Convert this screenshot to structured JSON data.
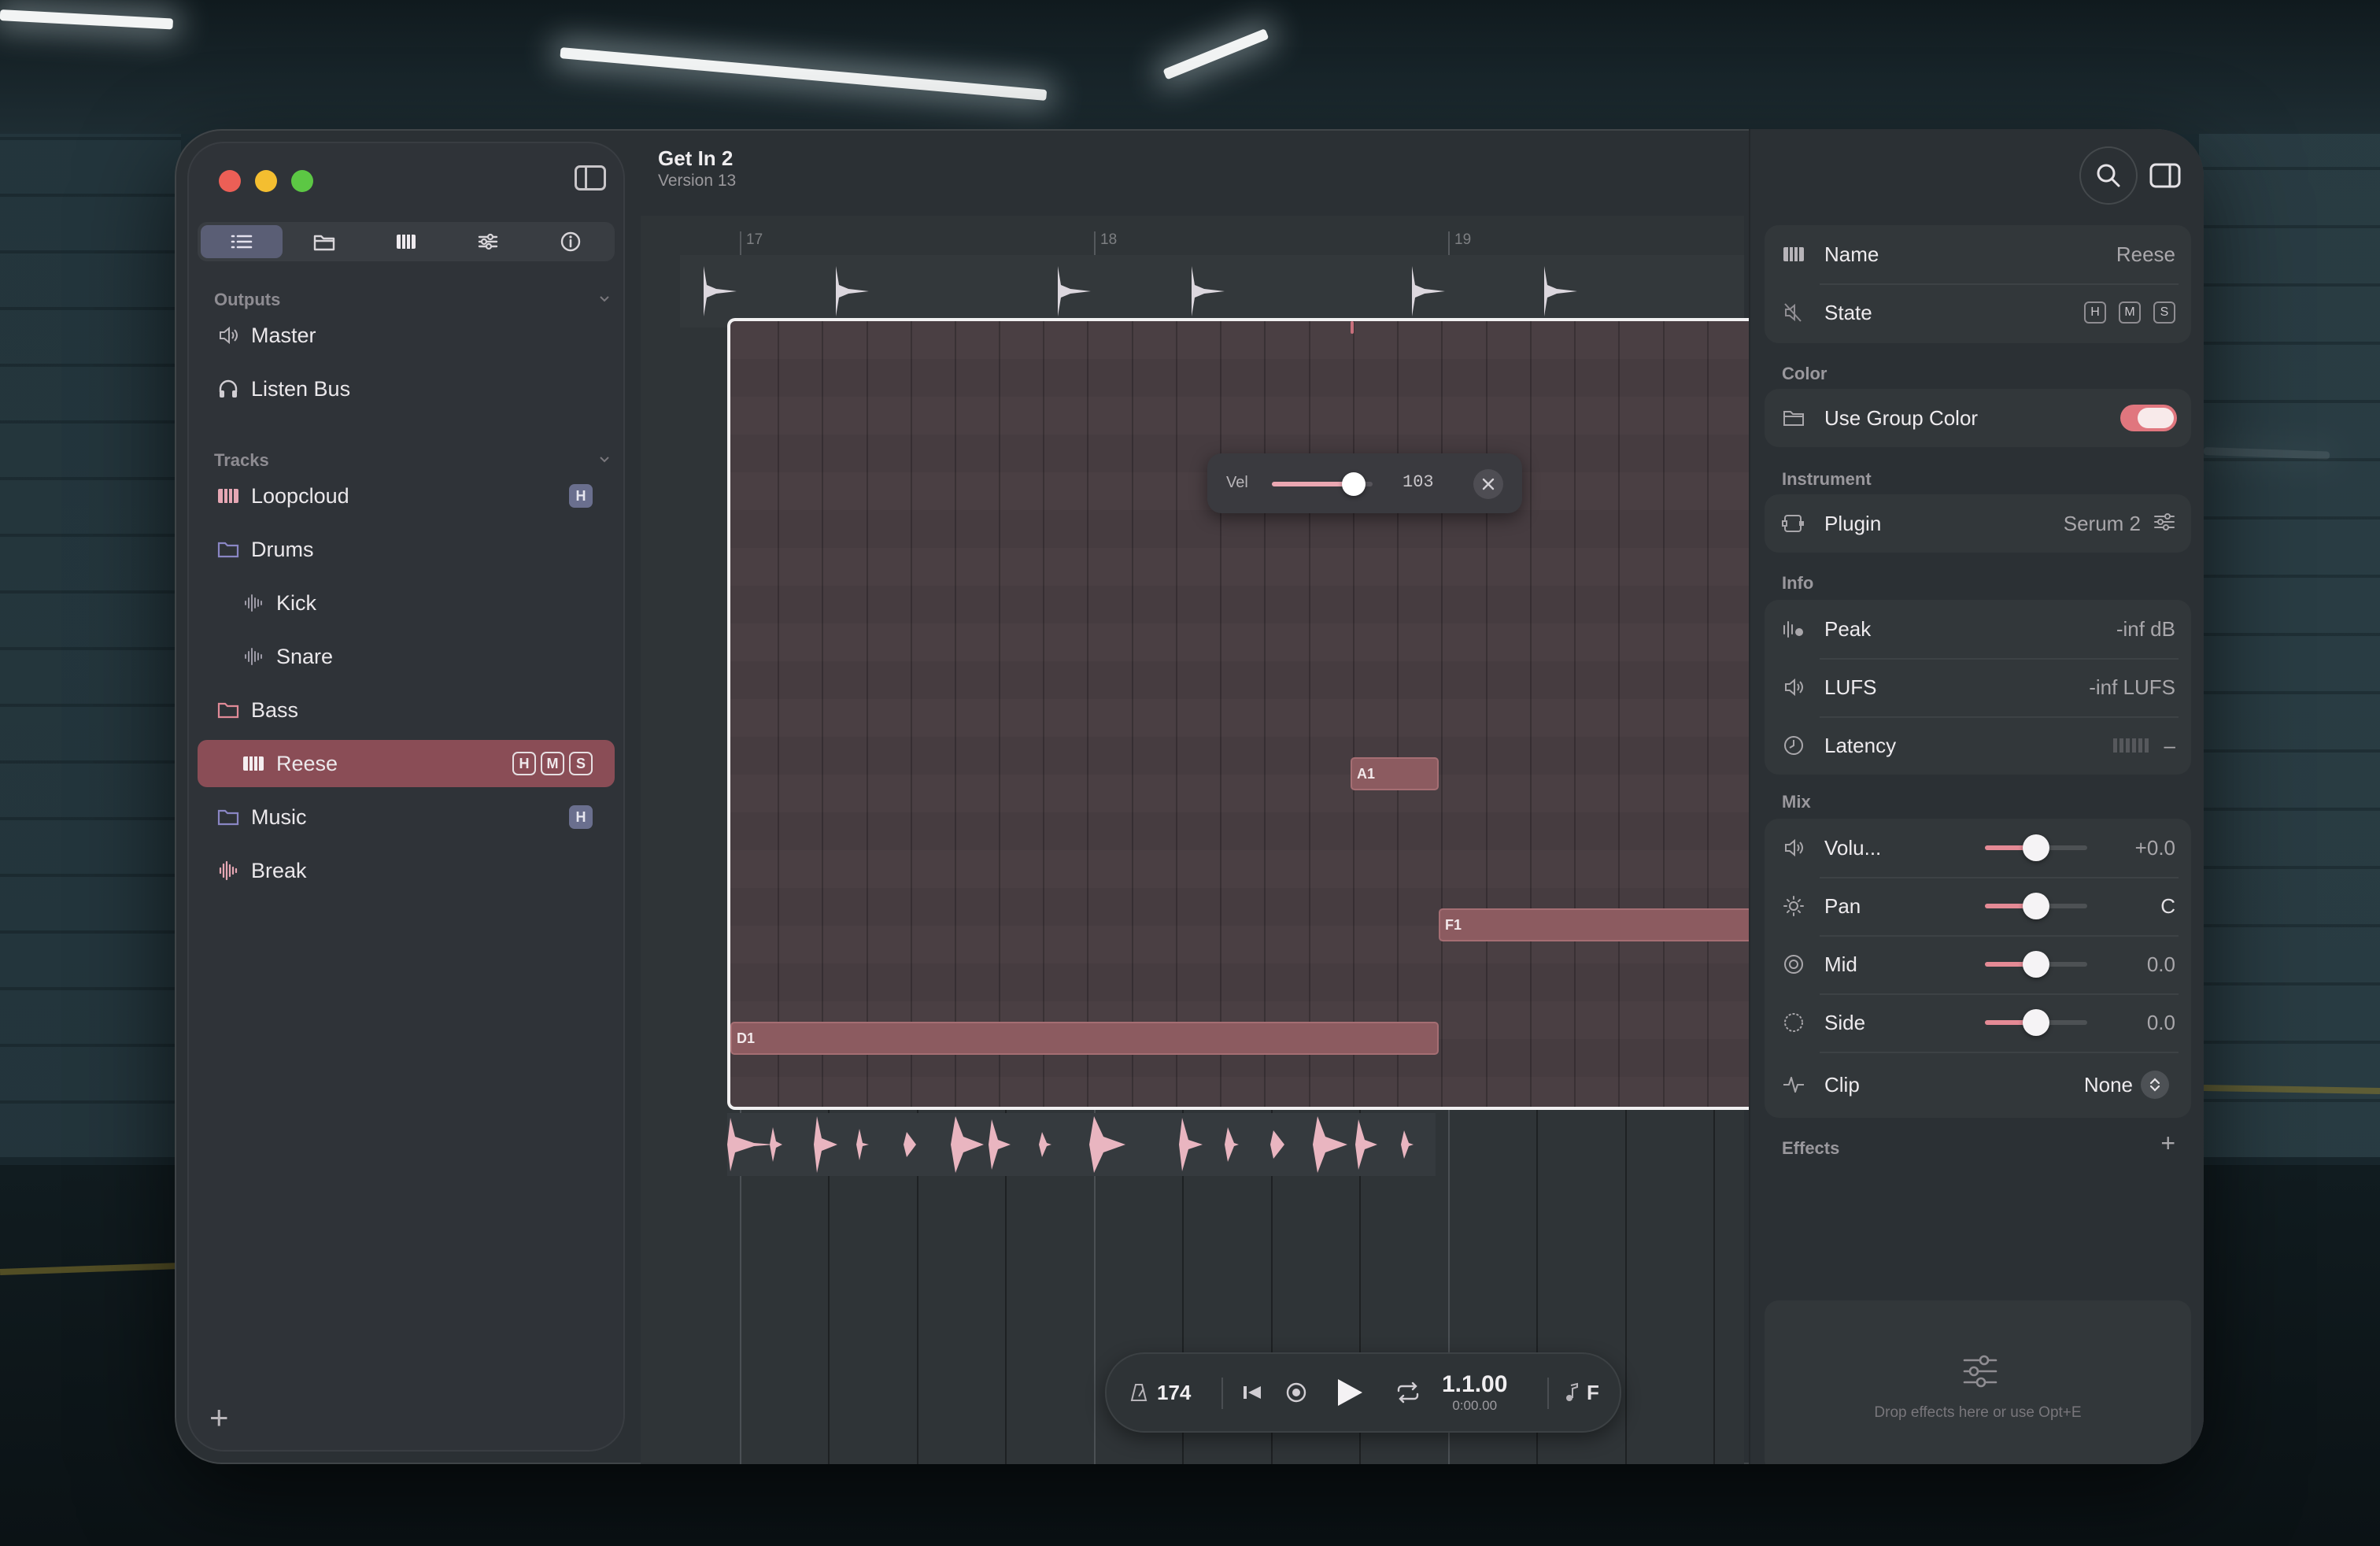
{
  "window": {
    "title": "Get In 2",
    "subtitle": "Version 13"
  },
  "sidebar": {
    "tabs": [
      {
        "icon": "list-icon",
        "active": true
      },
      {
        "icon": "folder-icon",
        "active": false
      },
      {
        "icon": "piano-icon",
        "active": false
      },
      {
        "icon": "mixer-icon",
        "active": false
      },
      {
        "icon": "info-icon",
        "active": false
      }
    ],
    "outputs_title": "Outputs",
    "outputs": [
      {
        "label": "Master",
        "icon": "speaker-icon"
      },
      {
        "label": "Listen Bus",
        "icon": "headphones-icon"
      }
    ],
    "tracks_title": "Tracks",
    "tracks": [
      {
        "label": "Loopcloud",
        "icon": "piano-icon",
        "badges": [
          "H"
        ]
      },
      {
        "label": "Drums",
        "icon": "folder-icon"
      },
      {
        "label": "Kick",
        "icon": "waveform-icon"
      },
      {
        "label": "Snare",
        "icon": "waveform-icon"
      },
      {
        "label": "Bass",
        "icon": "folder-icon"
      },
      {
        "label": "Reese",
        "icon": "piano-icon",
        "badges": [
          "H",
          "M",
          "S"
        ],
        "selected": true
      },
      {
        "label": "Music",
        "icon": "folder-icon",
        "badges": [
          "H"
        ]
      },
      {
        "label": "Break",
        "icon": "waveform-icon"
      }
    ],
    "add_label": "+"
  },
  "editor": {
    "ruler": [
      "17",
      "18",
      "19"
    ],
    "notes": [
      {
        "label": "A1"
      },
      {
        "label": "F1"
      },
      {
        "label": "D1"
      }
    ],
    "velocity": {
      "label": "Vel",
      "value": "103",
      "level": 0.81
    }
  },
  "transport": {
    "bpm": "174",
    "position": "1.1.00",
    "time": "0:00.00",
    "key": "F"
  },
  "inspector": {
    "name_label": "Name",
    "name_value": "Reese",
    "state_label": "State",
    "state_buttons": [
      "H",
      "M",
      "S"
    ],
    "color_section": "Color",
    "use_group_color": "Use Group Color",
    "use_group_color_on": true,
    "instrument_section": "Instrument",
    "plugin_label": "Plugin",
    "plugin_value": "Serum 2",
    "info_section": "Info",
    "peak_label": "Peak",
    "peak_value": "-inf dB",
    "lufs_label": "LUFS",
    "lufs_value": "-inf LUFS",
    "latency_label": "Latency",
    "latency_value": "–",
    "mix_section": "Mix",
    "mix": [
      {
        "label": "Volu...",
        "value": "+0.0",
        "level": 0.5,
        "icon": "speaker-icon"
      },
      {
        "label": "Pan",
        "value": "C",
        "level": 0.5,
        "icon": "sun-icon"
      },
      {
        "label": "Mid",
        "value": "0.0",
        "level": 0.5,
        "icon": "target-icon"
      },
      {
        "label": "Side",
        "value": "0.0",
        "level": 0.5,
        "icon": "circle-icon"
      }
    ],
    "clip_label": "Clip",
    "clip_value": "None",
    "effects_section": "Effects",
    "effects_add": "+",
    "effects_hint": "Drop effects here or use Opt+E"
  },
  "colors": {
    "accent": "#e0767e",
    "selected_row": "#8a4d56",
    "note": "#8c5b60",
    "badge": "#6a6f8e"
  }
}
